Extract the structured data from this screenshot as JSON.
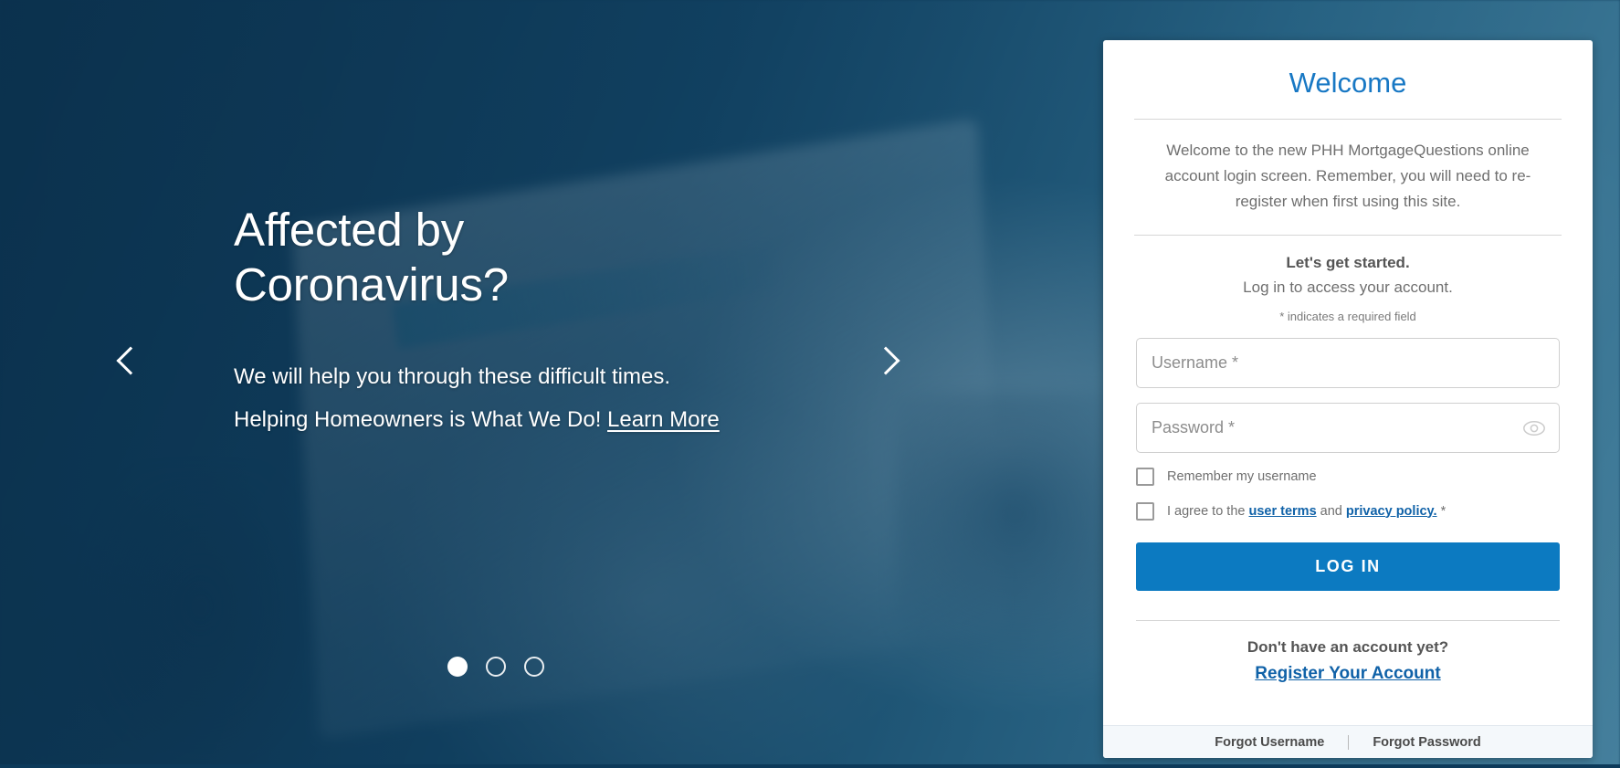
{
  "hero": {
    "title": "Affected by\nCoronavirus?",
    "subtitle_line1": "We will help you through these difficult times.",
    "subtitle_line2": "Helping Homeowners is What We Do! ",
    "learn_more": "Learn More",
    "prev_icon": "chevron-left-icon",
    "next_icon": "chevron-right-icon",
    "slides": [
      {
        "index": 1,
        "active": true
      },
      {
        "index": 2,
        "active": false
      },
      {
        "index": 3,
        "active": false
      }
    ]
  },
  "login": {
    "title": "Welcome",
    "welcome_text": "Welcome to the new PHH MortgageQuestions online account login screen. Remember, you will need to re-register when first using this site.",
    "lets_get_started": "Let's get started.",
    "log_in_to_access": "Log in to access your account.",
    "required_note": "* indicates a required field",
    "username": {
      "placeholder": "Username *",
      "value": ""
    },
    "password": {
      "placeholder": "Password *",
      "value": "",
      "toggle_icon": "eye-icon"
    },
    "remember_label": "Remember my username",
    "remember_checked": false,
    "agree_prefix": "I agree to the ",
    "agree_user_terms": "user terms",
    "agree_and": " and ",
    "agree_privacy": "privacy policy.",
    "agree_required_star": " *",
    "agree_checked": false,
    "login_button": "LOG IN",
    "no_account": "Don't have an account yet?",
    "register_link": "Register Your Account",
    "forgot_username": "Forgot Username",
    "forgot_password": "Forgot Password",
    "accent_color": "#0c7ac1",
    "title_color": "#1878c4",
    "link_color": "#1062a8"
  }
}
